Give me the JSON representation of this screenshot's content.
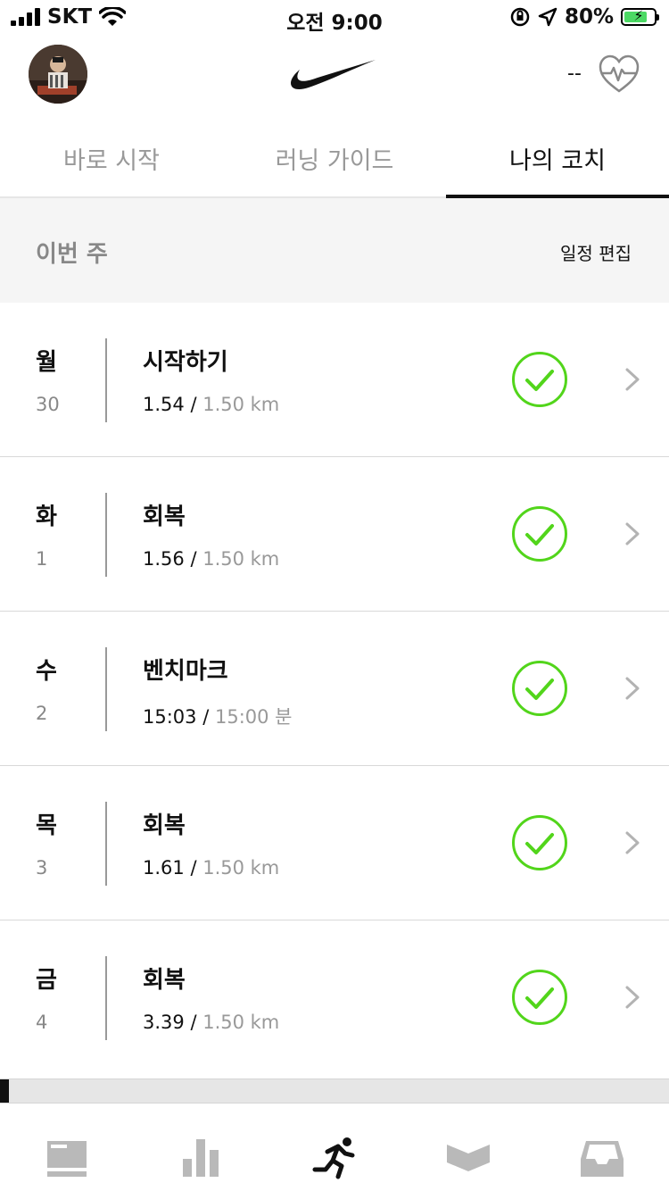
{
  "status_bar": {
    "carrier": "SKT",
    "time": "오전 9:00",
    "battery_percent": "80%",
    "battery_level": 0.8,
    "icons": [
      "signal-icon",
      "wifi-icon",
      "rotation-lock-icon",
      "location-icon",
      "battery-charging-icon"
    ]
  },
  "header": {
    "heart_rate_value": "--",
    "logo": "nike-swoosh",
    "icons": [
      "avatar",
      "heart-rate-icon"
    ]
  },
  "tabs": [
    {
      "label": "바로 시작",
      "active": false
    },
    {
      "label": "러닝 가이드",
      "active": false
    },
    {
      "label": "나의 코치",
      "active": true
    }
  ],
  "week": {
    "title": "이번 주",
    "edit_label": "일정 편집"
  },
  "items": [
    {
      "day": "월",
      "date": "30",
      "title": "시작하기",
      "actual": "1.54",
      "separator": " / ",
      "target": "1.50 km",
      "status": "completed"
    },
    {
      "day": "화",
      "date": "1",
      "title": "회복",
      "actual": "1.56",
      "separator": " / ",
      "target": "1.50 km",
      "status": "completed"
    },
    {
      "day": "수",
      "date": "2",
      "title": "벤치마크",
      "actual": "15:03",
      "separator": " / ",
      "target": "15:00 분",
      "status": "completed"
    },
    {
      "day": "목",
      "date": "3",
      "title": "회복",
      "actual": "1.61",
      "separator": " / ",
      "target": "1.50 km",
      "status": "completed"
    },
    {
      "day": "금",
      "date": "4",
      "title": "회복",
      "actual": "3.39",
      "separator": " / ",
      "target": "1.50 km",
      "status": "completed"
    }
  ],
  "plan_progress": 0.013,
  "bottom_nav": [
    {
      "icon": "feed-icon",
      "active": false
    },
    {
      "icon": "activity-icon",
      "active": false
    },
    {
      "icon": "run-icon",
      "active": true
    },
    {
      "icon": "clubs-icon",
      "active": false
    },
    {
      "icon": "inbox-icon",
      "active": false
    }
  ],
  "colors": {
    "accent_green": "#52d51b",
    "text_primary": "#111111",
    "text_secondary": "#999999",
    "section_bg": "#f5f5f5"
  }
}
